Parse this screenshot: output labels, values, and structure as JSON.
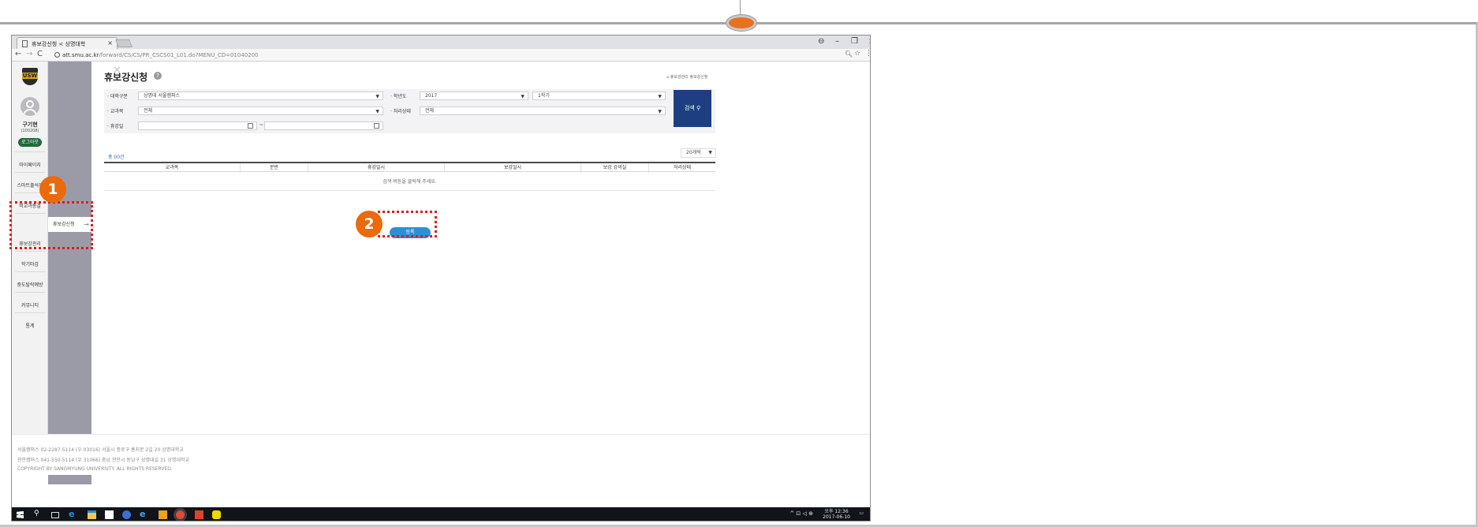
{
  "browser": {
    "tab_title": "휴보강신청 < 상명대학",
    "url_host": "att.smu.ac.kr",
    "url_path": "/forward/CS/CS/PR_CSCS01_L01.do?MENU_CD=01040200"
  },
  "sidebar": {
    "logo_text": "USW",
    "user_name": "구기현",
    "user_id": "(100208)",
    "logout_label": "로그아웃",
    "items": [
      "마이페이지",
      "스마트출석부",
      "비교과종결",
      "휴보강관리",
      "학기마감",
      "중도탈락예방",
      "커뮤니티",
      "통계"
    ]
  },
  "subpanel": {
    "item_label": "휴보강신청"
  },
  "content": {
    "title": "휴보강신청",
    "help_icon": "?",
    "breadcrumb": "휴보강관리 휴보강신청",
    "search": {
      "campus_label": "· 대학구분",
      "campus_value": "상명대 서울캠퍼스",
      "year_label": "· 학년도",
      "year_value": "2017",
      "term_value": "1학기",
      "subject_label": "· 교과목",
      "subject_value": "전체",
      "status_label": "· 처리상태",
      "status_value": "전체",
      "date_label": "· 휴강일",
      "date_separator": "~",
      "button_label": "검색"
    },
    "count_text": "총 00건",
    "page_size": "20개씩",
    "table": {
      "headers": [
        "교과목",
        "분반",
        "휴강일시",
        "보강일시",
        "보강 강의실",
        "처리상태"
      ],
      "empty_message": "검색 버튼을 클릭해 주세요."
    },
    "register_label": "등록"
  },
  "footer": {
    "line1": "서울캠퍼스 02-2287-5114 (우 03016) 서울시 종로구 홍지문 2길 20 상명대학교",
    "line2": "천안캠퍼스 041-550-5114 (우 31066) 충남 천안시 동남구 상명대길 31 상명대학교",
    "line3": "COPYRIGHT BY SANGMYUNG UNIVERSITY. ALL RIGHTS RESERVED."
  },
  "taskbar": {
    "time": "오후 12:36",
    "date": "2017-06-10",
    "tray": "^ ⊡ ◁ ⊕"
  },
  "annotations": {
    "badge1": "1",
    "badge2": "2"
  },
  "colors": {
    "accent_orange": "#ea6a0c",
    "annotation_red": "#e31a1a",
    "search_button": "#1d3f82",
    "register_button": "#2a90d8",
    "logout_button": "#1f6a3a",
    "subpanel": "#9b9ba8"
  }
}
